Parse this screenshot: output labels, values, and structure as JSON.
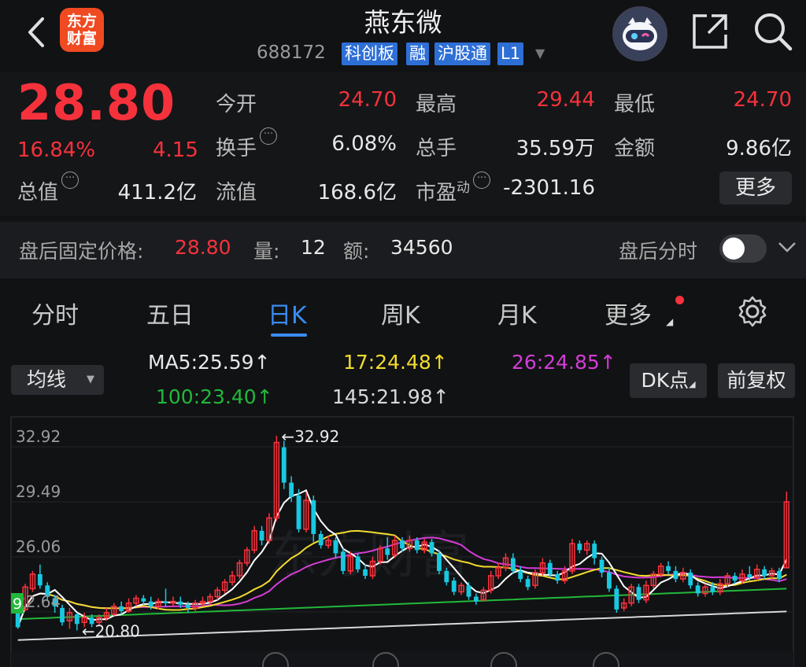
{
  "header": {
    "back_icon": "chevron-left-icon",
    "logo_line1": "东方",
    "logo_line2": "财富",
    "stock_name": "燕东微",
    "stock_code": "688172",
    "tags": [
      "科创板",
      "融",
      "沪股通",
      "L1"
    ],
    "avatar_icon": "robot-avatar-icon",
    "share_icon": "share-icon",
    "search_icon": "search-icon"
  },
  "quote": {
    "price": "28.80",
    "change_pct": "16.84%",
    "change_val": "4.15",
    "open_label": "今开",
    "open": "24.70",
    "high_label": "最高",
    "high": "29.44",
    "low_label": "最低",
    "low": "24.70",
    "turnover_label": "换手",
    "turnover": "6.08%",
    "volume_label": "总手",
    "volume": "35.59万",
    "amount_label": "金额",
    "amount": "9.86亿",
    "mktcap_label": "总值",
    "mktcap": "411.2亿",
    "float_label": "流值",
    "float": "168.6亿",
    "pe_label": "市盈",
    "pe_sup": "动",
    "pe": "-2301.16",
    "more_label": "更多"
  },
  "afterhours": {
    "label": "盘后固定价格:",
    "price": "28.80",
    "vol_label": "量:",
    "vol": "12",
    "amt_label": "额:",
    "amt": "34560",
    "intraday_label": "盘后分时"
  },
  "tabs": [
    "分时",
    "五日",
    "日K",
    "周K",
    "月K",
    "更多"
  ],
  "indicator": {
    "select_label": "均线",
    "ma5": "MA5:25.59↑",
    "ma17": "17:24.48↑",
    "ma26": "26:24.85↑",
    "ma100": "100:23.40↑",
    "ma145": "145:21.98↑",
    "dk_label": "DK点",
    "fq_label": "前复权"
  },
  "colors": {
    "up": "#f5323c",
    "down": "#19c8e0",
    "ma5": "#ffffff",
    "ma17": "#f2dc2e",
    "ma26": "#d43cd6",
    "ma100": "#22b83a",
    "ma145": "#d8d8d8",
    "accent": "#3a8cf0"
  },
  "chart_data": {
    "type": "candlestick",
    "y_ticks": [
      "32.92",
      "29.49",
      "26.06",
      "22.64"
    ],
    "ylim": [
      19.5,
      33.8
    ],
    "high_marker": "32.92",
    "low_marker": "20.80",
    "side_badge": "9",
    "candles": [
      [
        21.9,
        21.0,
        22.1,
        20.9
      ],
      [
        22.1,
        23.5,
        23.7,
        22.0
      ],
      [
        23.4,
        24.3,
        24.5,
        23.2
      ],
      [
        24.3,
        23.6,
        24.9,
        23.4
      ],
      [
        23.6,
        22.9,
        23.8,
        22.7
      ],
      [
        22.8,
        22.3,
        23.0,
        21.9
      ],
      [
        22.2,
        21.3,
        22.4,
        21.1
      ],
      [
        21.4,
        21.9,
        22.2,
        20.9
      ],
      [
        21.8,
        21.2,
        21.9,
        20.8
      ],
      [
        21.3,
        21.6,
        21.9,
        21.0
      ],
      [
        21.6,
        21.2,
        21.8,
        21.0
      ],
      [
        21.3,
        21.6,
        21.8,
        21.1
      ],
      [
        21.6,
        21.9,
        22.2,
        21.4
      ],
      [
        21.8,
        22.3,
        22.5,
        21.7
      ],
      [
        22.3,
        22.0,
        22.6,
        21.8
      ],
      [
        22.0,
        22.5,
        22.8,
        21.9
      ],
      [
        22.5,
        22.8,
        23.0,
        22.3
      ],
      [
        22.8,
        22.6,
        23.0,
        22.4
      ],
      [
        22.6,
        22.3,
        22.9,
        22.1
      ],
      [
        22.3,
        22.6,
        22.8,
        22.1
      ],
      [
        22.6,
        22.5,
        23.4,
        22.3
      ],
      [
        22.5,
        22.6,
        22.9,
        22.3
      ],
      [
        22.6,
        22.4,
        22.9,
        22.2
      ],
      [
        22.4,
        22.2,
        22.6,
        21.9
      ],
      [
        22.2,
        22.5,
        22.7,
        22.0
      ],
      [
        22.5,
        22.6,
        22.9,
        22.3
      ],
      [
        22.6,
        22.9,
        23.1,
        22.4
      ],
      [
        22.9,
        23.3,
        23.5,
        22.7
      ],
      [
        23.3,
        23.8,
        24.0,
        23.1
      ],
      [
        23.8,
        24.2,
        24.5,
        23.6
      ],
      [
        24.2,
        25.0,
        25.2,
        24.0
      ],
      [
        25.0,
        25.8,
        26.0,
        24.8
      ],
      [
        25.8,
        27.0,
        27.3,
        25.6
      ],
      [
        27.0,
        26.4,
        27.3,
        26.1
      ],
      [
        26.4,
        27.8,
        28.1,
        26.2
      ],
      [
        27.8,
        32.5,
        32.92,
        27.6
      ],
      [
        32.2,
        30.0,
        32.6,
        29.6
      ],
      [
        30.0,
        29.1,
        30.4,
        28.8
      ],
      [
        29.2,
        27.1,
        29.6,
        26.9
      ],
      [
        27.1,
        28.9,
        29.4,
        26.9
      ],
      [
        28.9,
        26.8,
        29.2,
        26.3
      ],
      [
        26.8,
        26.1,
        27.0,
        25.9
      ],
      [
        26.1,
        26.4,
        26.7,
        25.9
      ],
      [
        26.4,
        25.6,
        26.6,
        25.3
      ],
      [
        25.7,
        24.5,
        25.9,
        24.3
      ],
      [
        24.5,
        25.4,
        25.7,
        24.3
      ],
      [
        25.4,
        24.6,
        25.6,
        24.4
      ],
      [
        24.6,
        24.2,
        24.9,
        24.0
      ],
      [
        24.2,
        25.1,
        25.4,
        24.0
      ],
      [
        25.1,
        25.9,
        26.1,
        24.9
      ],
      [
        25.9,
        25.5,
        26.6,
        25.2
      ],
      [
        25.5,
        26.4,
        26.7,
        25.3
      ],
      [
        26.4,
        25.9,
        26.6,
        25.7
      ],
      [
        25.9,
        26.4,
        26.7,
        25.7
      ],
      [
        26.4,
        25.8,
        26.6,
        25.6
      ],
      [
        25.8,
        26.3,
        26.5,
        25.6
      ],
      [
        26.3,
        25.6,
        26.5,
        25.4
      ],
      [
        25.6,
        24.5,
        25.8,
        24.3
      ],
      [
        24.5,
        23.8,
        24.7,
        23.6
      ],
      [
        23.9,
        23.2,
        24.1,
        23.0
      ],
      [
        23.2,
        23.6,
        23.8,
        23.0
      ],
      [
        23.6,
        22.9,
        23.8,
        22.7
      ],
      [
        22.9,
        22.6,
        23.1,
        22.4
      ],
      [
        22.7,
        23.3,
        23.5,
        22.6
      ],
      [
        23.3,
        24.2,
        24.5,
        23.1
      ],
      [
        24.2,
        24.7,
        25.0,
        24.0
      ],
      [
        24.7,
        25.3,
        25.6,
        24.5
      ],
      [
        25.3,
        24.5,
        25.6,
        24.3
      ],
      [
        24.5,
        24.0,
        24.8,
        23.8
      ],
      [
        24.0,
        23.5,
        24.2,
        23.3
      ],
      [
        23.6,
        24.4,
        24.6,
        23.4
      ],
      [
        24.4,
        25.0,
        25.3,
        24.2
      ],
      [
        25.0,
        24.3,
        25.2,
        24.1
      ],
      [
        24.3,
        23.9,
        24.5,
        23.7
      ],
      [
        23.9,
        24.5,
        24.8,
        23.7
      ],
      [
        24.5,
        26.2,
        26.5,
        24.3
      ],
      [
        26.2,
        25.8,
        26.4,
        25.6
      ],
      [
        25.8,
        26.2,
        26.4,
        25.5
      ],
      [
        26.2,
        25.3,
        26.4,
        24.9
      ],
      [
        25.2,
        24.4,
        25.4,
        24.1
      ],
      [
        24.4,
        23.4,
        24.7,
        23.2
      ],
      [
        23.4,
        22.1,
        23.6,
        21.9
      ],
      [
        22.2,
        22.5,
        22.8,
        22.0
      ],
      [
        22.5,
        23.5,
        23.7,
        22.3
      ],
      [
        23.5,
        22.7,
        23.7,
        22.5
      ],
      [
        22.7,
        23.6,
        23.9,
        22.5
      ],
      [
        23.6,
        24.3,
        24.5,
        23.4
      ],
      [
        24.3,
        24.8,
        25.0,
        24.1
      ],
      [
        24.8,
        24.5,
        25.1,
        24.3
      ],
      [
        24.5,
        24.0,
        24.8,
        23.8
      ],
      [
        24.0,
        24.4,
        24.7,
        23.8
      ],
      [
        24.4,
        23.6,
        24.6,
        23.4
      ],
      [
        23.6,
        23.1,
        23.8,
        22.9
      ],
      [
        23.1,
        23.5,
        23.7,
        22.9
      ],
      [
        23.5,
        23.2,
        23.8,
        23.0
      ],
      [
        23.2,
        23.7,
        24.0,
        23.0
      ],
      [
        23.7,
        24.2,
        24.4,
        23.5
      ],
      [
        24.2,
        23.9,
        24.4,
        23.7
      ],
      [
        23.9,
        24.3,
        24.6,
        23.7
      ],
      [
        24.3,
        24.1,
        24.8,
        23.9
      ],
      [
        24.1,
        24.6,
        24.9,
        23.9
      ],
      [
        24.6,
        24.2,
        24.8,
        24.0
      ],
      [
        24.2,
        24.5,
        24.7,
        24.0
      ],
      [
        24.5,
        24.0,
        24.7,
        23.8
      ],
      [
        24.7,
        28.8,
        29.44,
        24.7
      ]
    ]
  }
}
